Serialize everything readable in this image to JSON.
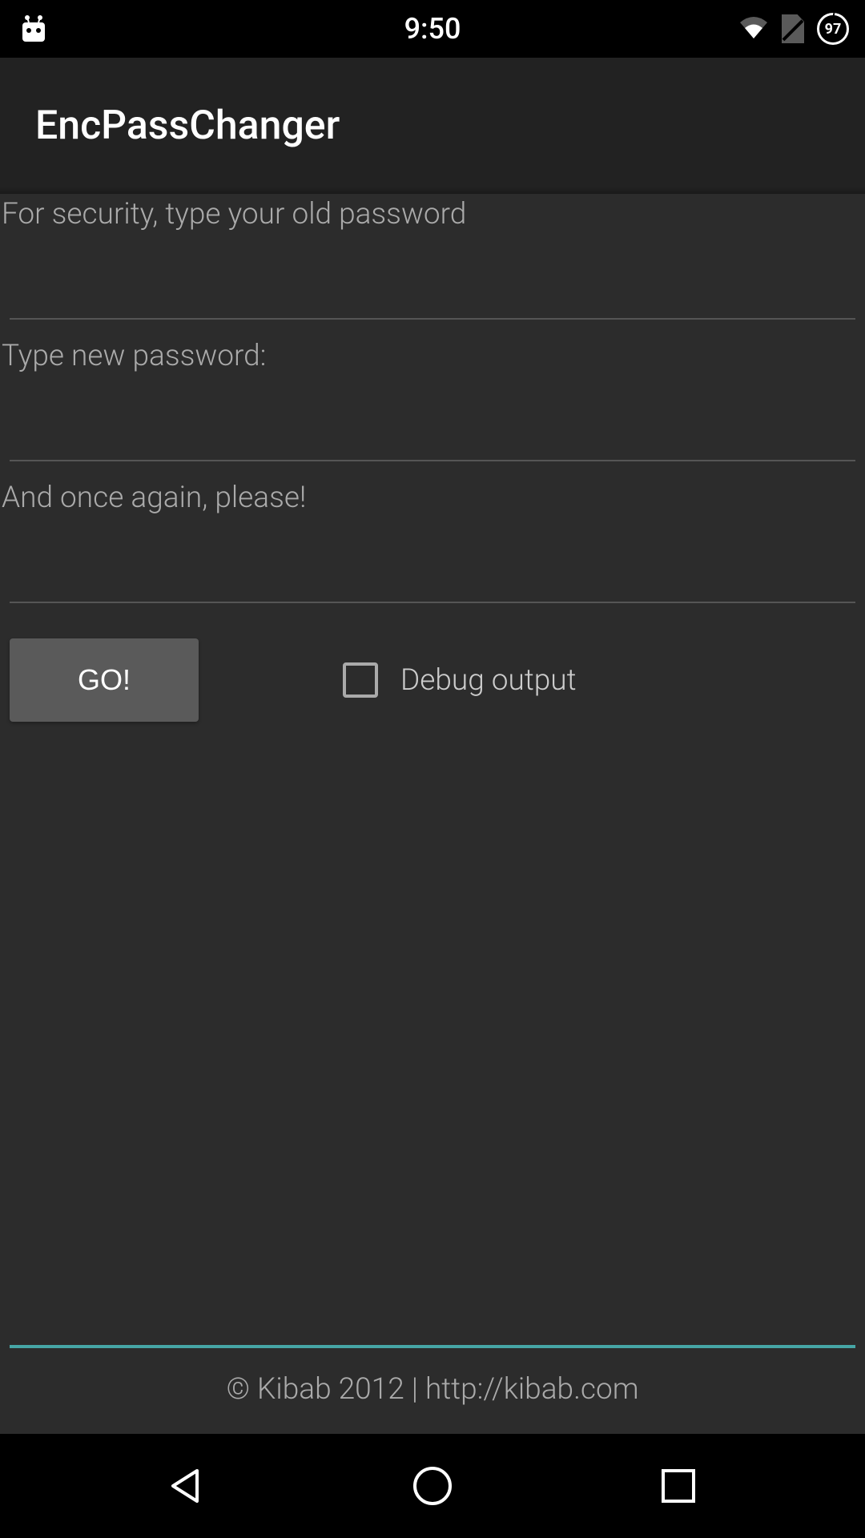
{
  "status_bar": {
    "time": "9:50",
    "battery_level": "97"
  },
  "header": {
    "app_title": "EncPassChanger"
  },
  "form": {
    "old_password_label": "For security, type your old password",
    "old_password_value": "",
    "new_password_label": "Type new password:",
    "new_password_value": "",
    "confirm_password_label": "And once again, please!",
    "confirm_password_value": "",
    "go_button_label": "GO!",
    "debug_checkbox_label": "Debug output",
    "debug_checkbox_checked": false
  },
  "footer": {
    "copyright": "© Kibab 2012 | http://kibab.com"
  }
}
